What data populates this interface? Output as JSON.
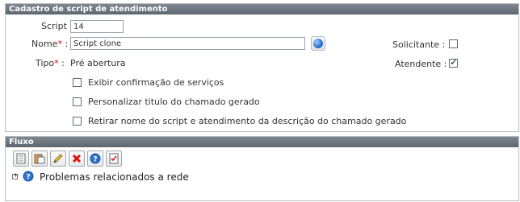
{
  "form_panel": {
    "title": "Cadastro de script de atendimento",
    "script_label": "Script :",
    "script_value": "14",
    "nome_label": "Nome",
    "nome_required": "*",
    "nome_sep": ":",
    "nome_value": "Script clone",
    "tipo_label": "Tipo",
    "tipo_required": "*",
    "tipo_sep": ":",
    "tipo_value": "Pré abertura",
    "solicitante_label": "Solicitante :",
    "solicitante_checked": false,
    "atendente_label": "Atendente :",
    "atendente_checked": true,
    "options": [
      {
        "label": "Exibir confirmação de serviços",
        "checked": false
      },
      {
        "label": "Personalizar titulo do chamado gerado",
        "checked": false
      },
      {
        "label": "Retirar nome do script e atendimento da descrição do chamado gerado",
        "checked": false
      }
    ]
  },
  "flow_panel": {
    "title": "Fluxo",
    "toolbar_icons": [
      "document-icon",
      "paste-icon",
      "edit-pencil-icon",
      "delete-icon",
      "help-icon",
      "checklist-icon"
    ],
    "tree_item_label": "Problemas relacionados a rede",
    "tree_expand_symbol": "+"
  }
}
